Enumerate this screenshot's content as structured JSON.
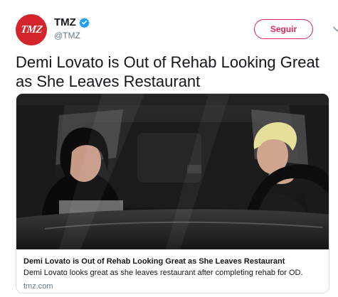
{
  "tweet": {
    "account": {
      "display_name": "TMZ",
      "handle": "@TMZ",
      "avatar_text": "TMZ",
      "verified": true
    },
    "follow_label": "Seguir",
    "text": "Demi Lovato is Out of Rehab Looking Great as She Leaves Restaurant",
    "card": {
      "title": "Demi Lovato is Out of Rehab Looking Great as She Leaves Restaurant",
      "description": "Demi Lovato looks great as she leaves restaurant after completing rehab for OD.",
      "domain": "tmz.com",
      "image_description_icon": "photo"
    }
  },
  "colors": {
    "brand_red": "#d3252b",
    "follow_accent": "#e0245e",
    "verified_blue": "#1da1f2",
    "secondary_text": "#657786",
    "border": "#d8dee3"
  }
}
